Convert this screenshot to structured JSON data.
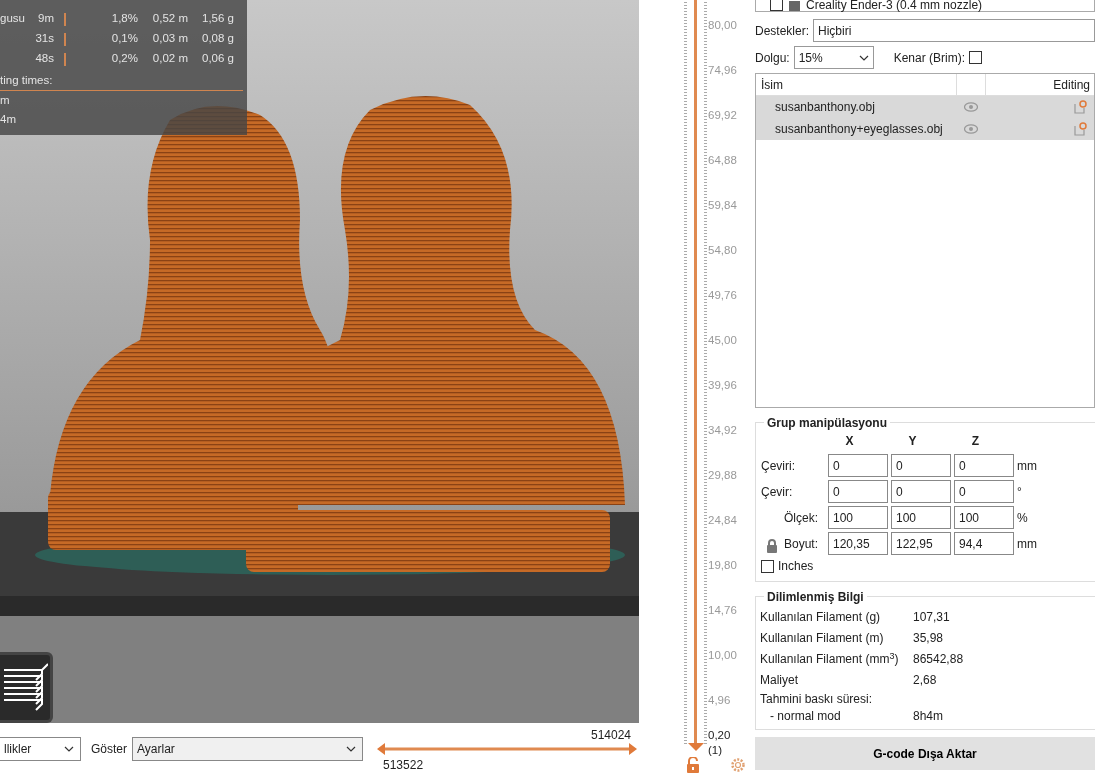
{
  "legend": {
    "rows": [
      {
        "name": "gusu",
        "time": "9m",
        "percent": "1,8%",
        "length": "0,52 m",
        "weight": "1,56 g"
      },
      {
        "time": "31s",
        "percent": "0,1%",
        "length": "0,03 m",
        "weight": "0,08 g"
      },
      {
        "time": "48s",
        "percent": "0,2%",
        "length": "0,02 m",
        "weight": "0,06 g"
      }
    ],
    "section_title": "ting times:",
    "times": [
      "m",
      "4m"
    ]
  },
  "bottom_bar": {
    "view_select": "llikler",
    "show_label": "Göster",
    "show_select": "Ayarlar",
    "range_upper": "514024",
    "range_lower": "513522",
    "level": 1
  },
  "layer_slider": {
    "ticks": [
      "80,00",
      "74,96",
      "69,92",
      "64,88",
      "59,84",
      "54,80",
      "49,76",
      "45,00",
      "39,96",
      "34,92",
      "29,88",
      "24,84",
      "19,80",
      "14,76",
      "10,00",
      "4,96"
    ],
    "current": "0,20",
    "current_index": "(1)",
    "level": 1
  },
  "printer": {
    "label": "Creality Ender-3 (0.4 mm nozzle)",
    "checked": false
  },
  "supports": {
    "label": "Destekler:",
    "value": "Hiçbiri"
  },
  "infill": {
    "label": "Dolgu:",
    "value": "15%"
  },
  "brim": {
    "label": "Kenar (Brim):",
    "checked": false
  },
  "objects": {
    "columns": [
      "İsim",
      "Editing"
    ],
    "rows": [
      {
        "name": "susanbanthony.obj",
        "selected": true
      },
      {
        "name": "susanbanthony+eyeglasses.obj",
        "selected": true
      }
    ]
  },
  "manipulation": {
    "title": "Grup manipülasyonu",
    "axes": [
      "X",
      "Y",
      "Z"
    ],
    "rows": [
      {
        "label": "Çeviri:",
        "values": [
          "0",
          "0",
          "0"
        ],
        "unit": "mm"
      },
      {
        "label": "Çevir:",
        "values": [
          "0",
          "0",
          "0"
        ],
        "unit": "°"
      },
      {
        "label": "Ölçek:",
        "values": [
          "100",
          "100",
          "100"
        ],
        "unit": "%"
      },
      {
        "label": "Boyut:",
        "values": [
          "120,35",
          "122,95",
          "94,4"
        ],
        "unit": "mm"
      }
    ],
    "inches": {
      "label": "Inches",
      "checked": false
    }
  },
  "sliced_info": {
    "title": "Dilimlenmiş Bilgi",
    "rows": [
      {
        "label": "Kullanılan Filament (g)",
        "value": "107,31"
      },
      {
        "label": "Kullanılan Filament (m)",
        "value": "35,98"
      },
      {
        "label": "Kullanılan Filament (mm$^{3}$)",
        "value": "86542,88"
      },
      {
        "label": "Maliyet",
        "value": "2,68"
      }
    ],
    "time_title": "Tahmini baskı süresi:",
    "time_rows": [
      {
        "label": "- normal mod",
        "value": "8h4m"
      }
    ]
  },
  "export_button": "G-code Dışa Aktar"
}
